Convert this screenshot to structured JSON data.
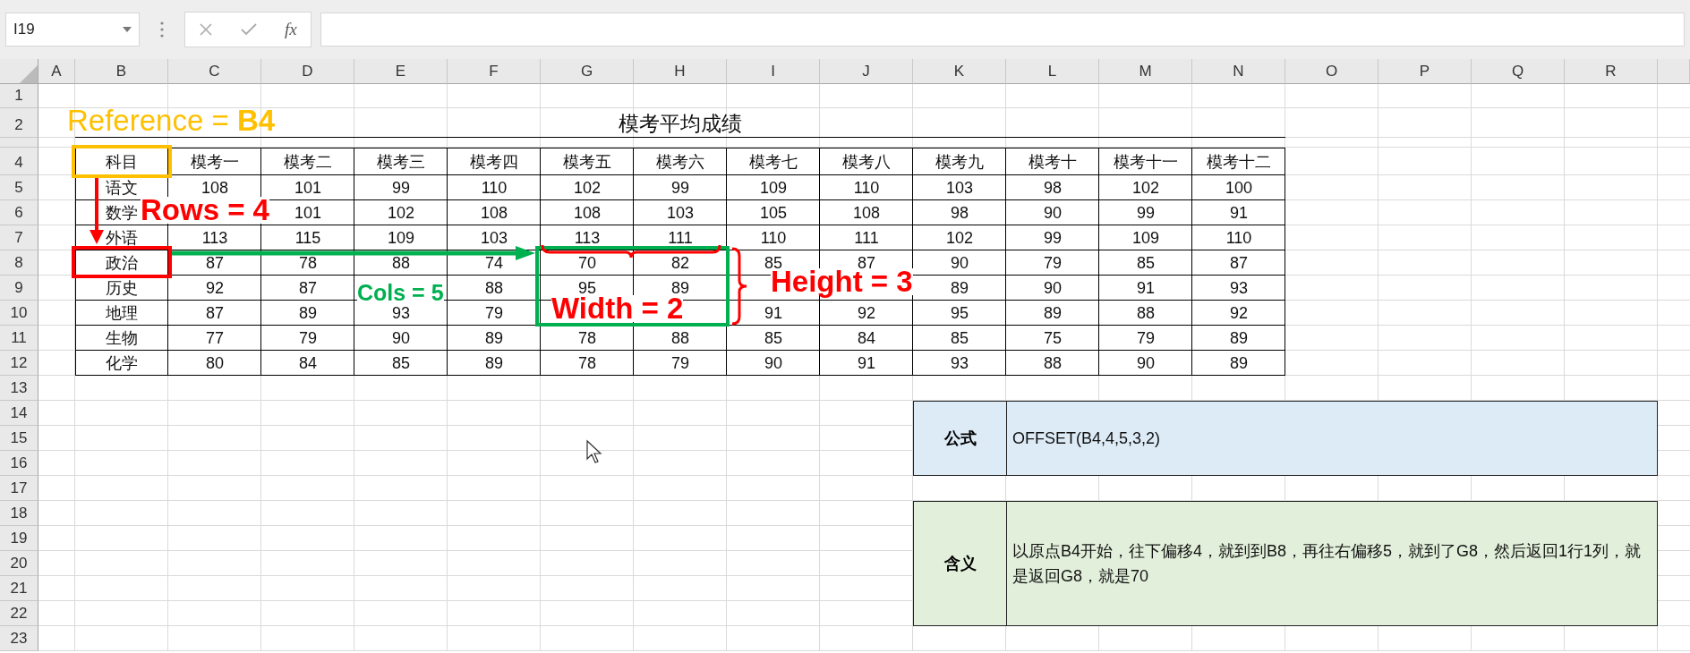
{
  "name_box": {
    "value": "I19"
  },
  "formula_bar": {
    "fx": "fx"
  },
  "columns": [
    "A",
    "B",
    "C",
    "D",
    "E",
    "F",
    "G",
    "H",
    "I",
    "J",
    "K",
    "L",
    "M",
    "N",
    "O",
    "P",
    "Q",
    "R"
  ],
  "rows": [
    {
      "kind": "row",
      "label": "1"
    },
    {
      "kind": "row",
      "label": "2"
    },
    {
      "kind": "collapsed"
    },
    {
      "kind": "row",
      "label": "4"
    },
    {
      "kind": "row",
      "label": "5"
    },
    {
      "kind": "row",
      "label": "6"
    },
    {
      "kind": "row",
      "label": "7"
    },
    {
      "kind": "row",
      "label": "8"
    },
    {
      "kind": "row",
      "label": "9"
    },
    {
      "kind": "row",
      "label": "10"
    },
    {
      "kind": "row",
      "label": "11"
    },
    {
      "kind": "row",
      "label": "12"
    },
    {
      "kind": "row",
      "label": "13"
    },
    {
      "kind": "row",
      "label": "14"
    },
    {
      "kind": "row",
      "label": "15"
    },
    {
      "kind": "row",
      "label": "16"
    },
    {
      "kind": "row",
      "label": "17"
    },
    {
      "kind": "row",
      "label": "18"
    },
    {
      "kind": "row",
      "label": "19"
    },
    {
      "kind": "row",
      "label": "20"
    },
    {
      "kind": "row",
      "label": "21"
    },
    {
      "kind": "row",
      "label": "22"
    },
    {
      "kind": "row",
      "label": "23"
    }
  ],
  "title": "模考平均成绩",
  "table": {
    "header": [
      "科目",
      "模考一",
      "模考二",
      "模考三",
      "模考四",
      "模考五",
      "模考六",
      "模考七",
      "模考八",
      "模考九",
      "模考十",
      "模考十一",
      "模考十二"
    ],
    "rows": [
      [
        "语文",
        "108",
        "101",
        "99",
        "110",
        "102",
        "99",
        "109",
        "110",
        "103",
        "98",
        "102",
        "100"
      ],
      [
        "数学",
        {
          "kind": "covered"
        },
        "101",
        "102",
        "108",
        "108",
        "103",
        "105",
        "108",
        "98",
        "90",
        "99",
        "91"
      ],
      [
        "外语",
        "113",
        "115",
        "109",
        "103",
        "113",
        "111",
        "110",
        "111",
        "102",
        "99",
        "109",
        "110"
      ],
      [
        "政治",
        "87",
        "78",
        "88",
        "74",
        "70",
        "82",
        "85",
        "87",
        "90",
        "79",
        "85",
        "87"
      ],
      [
        "历史",
        "92",
        "87",
        {
          "kind": "covered"
        },
        "88",
        "95",
        "89",
        {
          "kind": "covered"
        },
        {
          "kind": "covered"
        },
        "89",
        "90",
        "91",
        "93"
      ],
      [
        "地理",
        "87",
        "89",
        "93",
        "79",
        {
          "kind": "covered"
        },
        {
          "kind": "covered"
        },
        "91",
        "92",
        "95",
        "89",
        "88",
        "92"
      ],
      [
        "生物",
        "77",
        "79",
        "90",
        "89",
        "78",
        "88",
        "85",
        "84",
        "85",
        "75",
        "79",
        "89"
      ],
      [
        "化学",
        "80",
        "84",
        "85",
        "89",
        "78",
        "79",
        "90",
        "91",
        "93",
        "88",
        "90",
        "89"
      ]
    ]
  },
  "info_boxes": [
    {
      "label": "公式",
      "text": "OFFSET(B4,4,5,3,2)",
      "color": "#ddebf7"
    },
    {
      "label": "含义",
      "text": "以原点B4开始，往下偏移4，就到到B8，再往右偏移5，就到了G8，然后返回1行1列，就是返回G8，就是70",
      "color": "#e2efda"
    }
  ],
  "annotations": [
    {
      "text": "Reference = **B4**",
      "color": "#ffc000"
    },
    {
      "text": "Rows = 4",
      "color": "#ff0000"
    },
    {
      "text": "Cols = 5",
      "color": "#00b050"
    },
    {
      "text": "Width = 2",
      "color": "#ff0000"
    },
    {
      "text": "Height = 3",
      "color": "#ff0000"
    }
  ],
  "marks": [
    {
      "kind": "box",
      "color": "#ffc000"
    },
    {
      "kind": "box",
      "color": "#ff0000"
    },
    {
      "kind": "arrow-down",
      "color": "#ff0000"
    },
    {
      "kind": "arrow-right",
      "color": "#00b050"
    },
    {
      "kind": "box",
      "color": "#00b050"
    },
    {
      "kind": "brace-down",
      "color": "#ff0000"
    },
    {
      "kind": "brace-right",
      "color": "#ff0000"
    }
  ]
}
